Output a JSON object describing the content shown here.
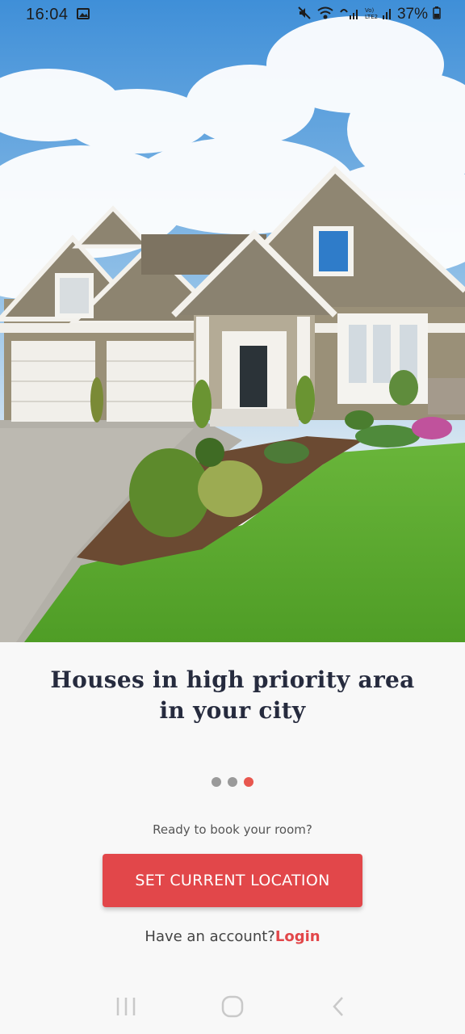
{
  "status_bar": {
    "time": "16:04",
    "battery_percent": "37%",
    "icons": [
      "gallery-icon",
      "mute-icon",
      "wifi-icon",
      "signal-icon",
      "volte-icon",
      "battery-icon"
    ]
  },
  "hero": {
    "image_subject": "house-photo"
  },
  "headline": {
    "line1": "Houses in high priority area",
    "line2": "in your city"
  },
  "pager": {
    "total": 3,
    "active_index": 2,
    "active_color": "#e8574f",
    "inactive_color": "#9a9a9a"
  },
  "prompt_text": "Ready to book your room?",
  "cta": {
    "label": "SET CURRENT LOCATION",
    "color": "#e2474a"
  },
  "account": {
    "text": "Have an account?",
    "login_label": "Login"
  },
  "nav_bar": {
    "buttons": [
      "recents-icon",
      "home-icon",
      "back-icon"
    ]
  }
}
